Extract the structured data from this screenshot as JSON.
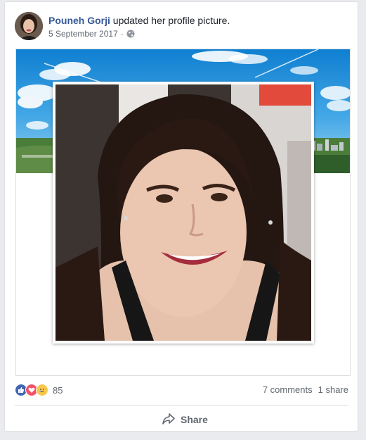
{
  "post": {
    "author": "Pouneh Gorji",
    "action": "updated her profile picture.",
    "date": "5 September 2017",
    "separator": "·",
    "privacy_icon": "globe-icon"
  },
  "footer": {
    "reaction_icons": [
      "like-icon",
      "love-icon",
      "sad-icon"
    ],
    "reaction_count": "85",
    "comments": "7 comments",
    "shares": "1 share",
    "share_label": "Share"
  },
  "colors": {
    "author_link": "#365899",
    "meta_text": "#616770",
    "background": "#e9ebee",
    "like": "#4267b2",
    "love": "#f25268",
    "sad": "#f7c84b"
  }
}
